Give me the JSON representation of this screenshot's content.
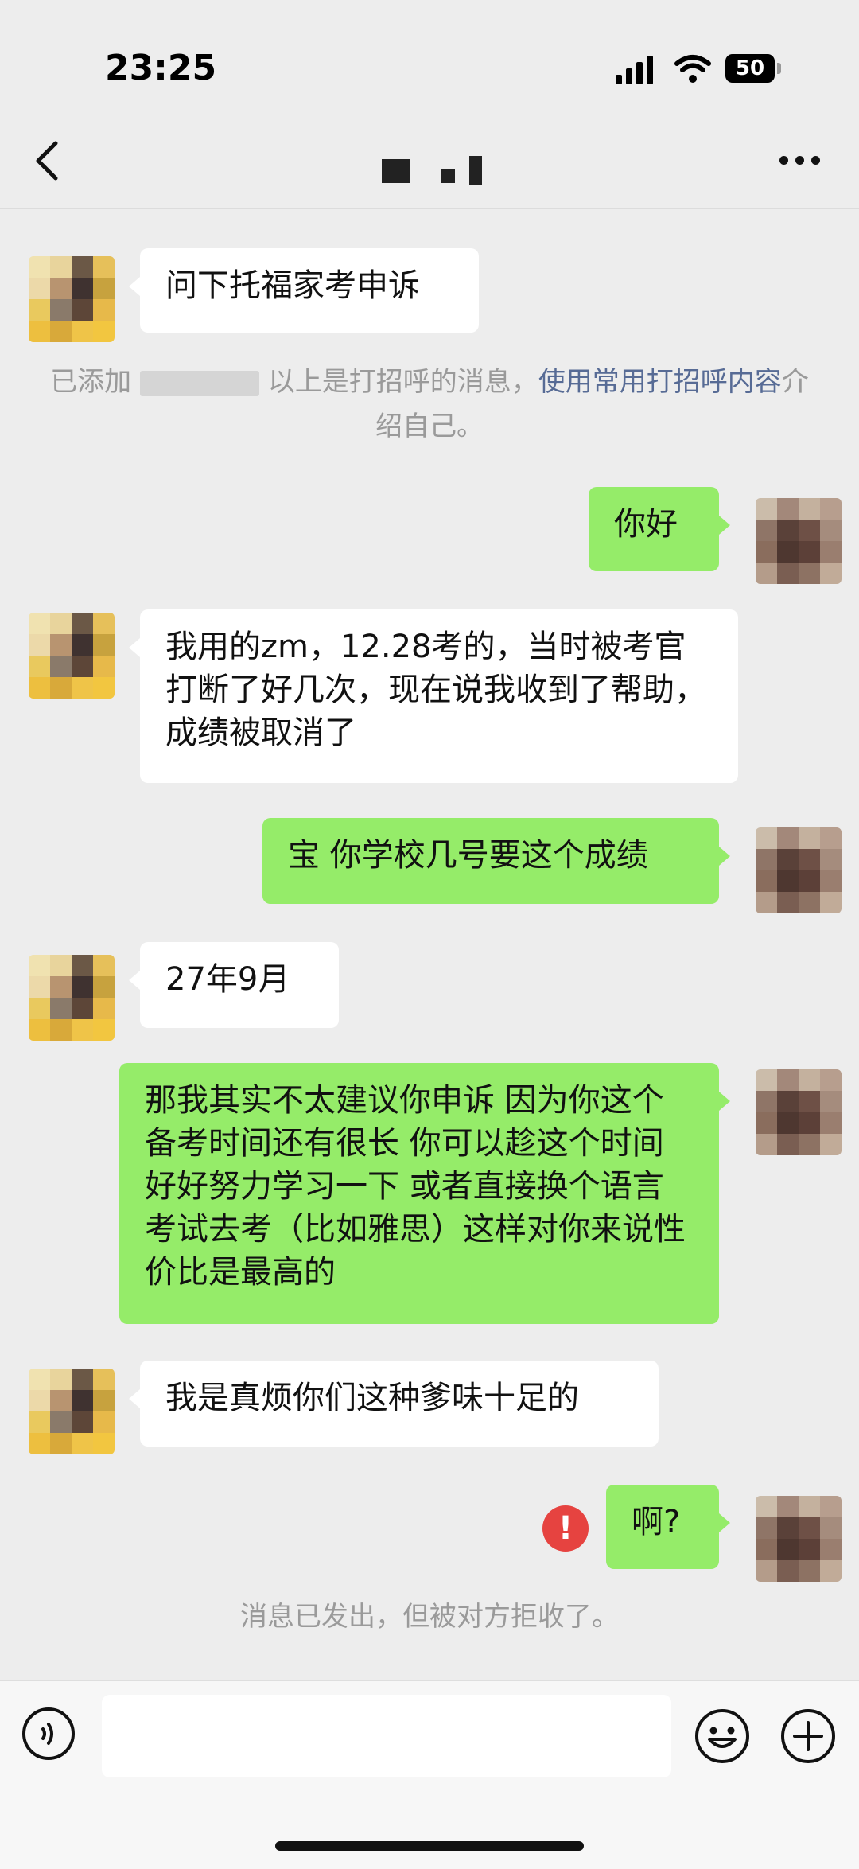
{
  "status_bar": {
    "time": "23:25",
    "battery": "50"
  },
  "header": {
    "title": ""
  },
  "messages": {
    "m1": "问下托福家考申诉",
    "sys1": {
      "prefix": "已添加",
      "middle": "以上是打招呼的消息，",
      "link": "使用常用打招呼内容",
      "suffix": "介绍自己。"
    },
    "m2": "你好",
    "m3": "我用的zm，12.28考的，当时被考官打断了好几次，现在说我收到了帮助，成绩被取消了",
    "m4": "宝 你学校几号要这个成绩",
    "m5": "27年9月",
    "m6": "那我其实不太建议你申诉 因为你这个备考时间还有很长 你可以趁这个时间好好努力学习一下 或者直接换个语言考试去考（比如雅思）这样对你来说性价比是最高的",
    "m7": "我是真烦你们这种爹味十足的",
    "m8": "啊?",
    "sys2": "消息已发出，但被对方拒收了。"
  },
  "input": {
    "placeholder": ""
  },
  "colors": {
    "out_bubble": "#95ec69",
    "in_bubble": "#ffffff",
    "link": "#576b95",
    "error": "#e64340",
    "background": "#ededed"
  },
  "icons": [
    "back-icon",
    "more-icon",
    "voice-icon",
    "emoji-icon",
    "plus-icon",
    "error-icon",
    "signal-icon",
    "wifi-icon",
    "battery-icon"
  ]
}
